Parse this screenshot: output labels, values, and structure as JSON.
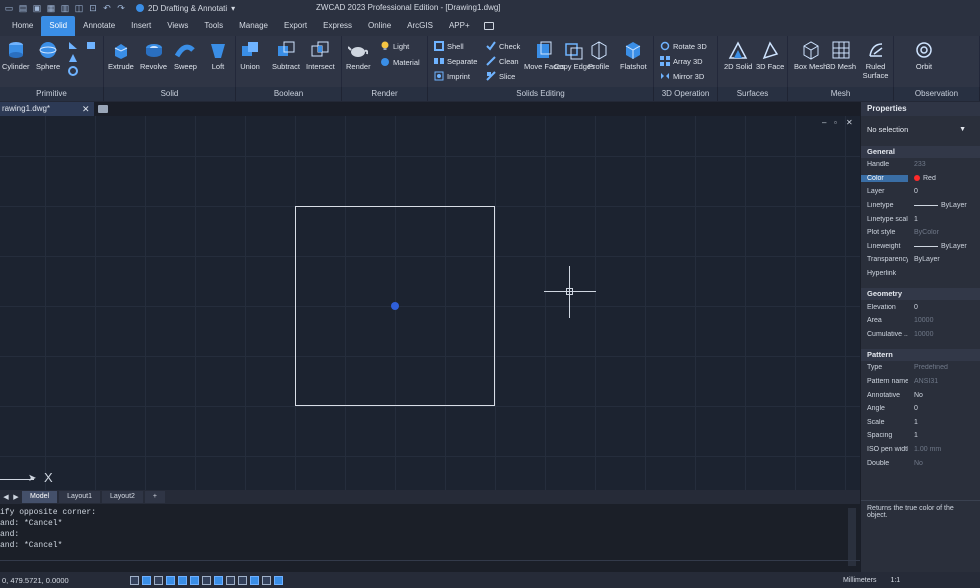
{
  "title_bar": {
    "workspace_label": "2D Drafting & Annotati",
    "app_title": "ZWCAD 2023 Professional Edition - [Drawing1.dwg]",
    "qat_icons": [
      "new-icon",
      "open-icon",
      "save-icon",
      "saveas-icon",
      "print-icon",
      "print-preview-icon",
      "plot-icon",
      "undo-icon",
      "redo-icon"
    ]
  },
  "menu": {
    "tabs": [
      "Home",
      "Solid",
      "Annotate",
      "Insert",
      "Views",
      "Tools",
      "Manage",
      "Export",
      "Express",
      "Online",
      "ArcGIS",
      "APP+"
    ],
    "active": "Solid"
  },
  "ribbon": {
    "primitive": {
      "label": "Primitive",
      "buttons": [
        "Cylinder",
        "Sphere"
      ]
    },
    "solid": {
      "label": "Solid",
      "buttons": [
        "Extrude",
        "Revolve",
        "Sweep",
        "Loft"
      ]
    },
    "boolean": {
      "label": "Boolean",
      "buttons": [
        "Union",
        "Subtract",
        "Intersect"
      ]
    },
    "render": {
      "label": "Render",
      "buttons": [
        "Render"
      ],
      "small": [
        "Light",
        "Material"
      ]
    },
    "solids_editing": {
      "label": "Solids Editing",
      "small": [
        "Shell",
        "Separate",
        "Imprint",
        "Check",
        "Clean",
        "Slice"
      ],
      "buttons": [
        "Move Faces",
        "Copy Edges",
        "Profile",
        "Flatshot"
      ]
    },
    "op3d": {
      "label": "3D Operation",
      "small": [
        "Rotate 3D",
        "Array 3D",
        "Mirror 3D"
      ]
    },
    "surfaces": {
      "label": "Surfaces",
      "buttons": [
        "2D Solid",
        "3D Face"
      ]
    },
    "mesh": {
      "label": "Mesh",
      "buttons": [
        "Box Mesh",
        "3D Mesh",
        "Ruled Surface"
      ]
    },
    "observation": {
      "label": "Observation",
      "buttons": [
        "Orbit"
      ]
    }
  },
  "doc_tab": {
    "name": "rawing1.dwg*",
    "close": "✕"
  },
  "layout_tabs": [
    "Model",
    "Layout1",
    "Layout2",
    "+"
  ],
  "command": {
    "lines": [
      "ify opposite corner:",
      "and: *Cancel*",
      "and:",
      "and: *Cancel*"
    ]
  },
  "status": {
    "coords": "0, 479.5721, 0.0000",
    "units": "Millimeters",
    "scale": "1:1"
  },
  "properties": {
    "title": "Properties",
    "selection": "No selection",
    "general_label": "General",
    "general": [
      {
        "k": "Handle",
        "v": "233",
        "dim": true
      },
      {
        "k": "Color",
        "v": "Red"
      },
      {
        "k": "Layer",
        "v": "0"
      },
      {
        "k": "Linetype",
        "v": "ByLayer"
      },
      {
        "k": "Linetype scale",
        "v": "1"
      },
      {
        "k": "Plot style",
        "v": "ByColor",
        "dim": true
      },
      {
        "k": "Lineweight",
        "v": "ByLayer"
      },
      {
        "k": "Transparency",
        "v": "ByLayer"
      },
      {
        "k": "Hyperlink",
        "v": ""
      }
    ],
    "geometry_label": "Geometry",
    "geometry": [
      {
        "k": "Elevation",
        "v": "0"
      },
      {
        "k": "Area",
        "v": "10000",
        "dim": true
      },
      {
        "k": "Cumulative ...",
        "v": "10000",
        "dim": true
      }
    ],
    "pattern_label": "Pattern",
    "pattern": [
      {
        "k": "Type",
        "v": "Predefined",
        "dim": true
      },
      {
        "k": "Pattern name",
        "v": "ANSI31",
        "dim": true
      },
      {
        "k": "Annotative",
        "v": "No"
      },
      {
        "k": "Angle",
        "v": "0"
      },
      {
        "k": "Scale",
        "v": "1"
      },
      {
        "k": "Spacing",
        "v": "1"
      },
      {
        "k": "ISO pen width",
        "v": "1.00 mm",
        "dim": true
      },
      {
        "k": "Double",
        "v": "No",
        "dim": true
      }
    ],
    "description": "Returns the true color of the object."
  },
  "colors": {
    "accent": "#3a8ee6",
    "grip": "#2f5fd9",
    "object_color": "#ff2a2a"
  }
}
